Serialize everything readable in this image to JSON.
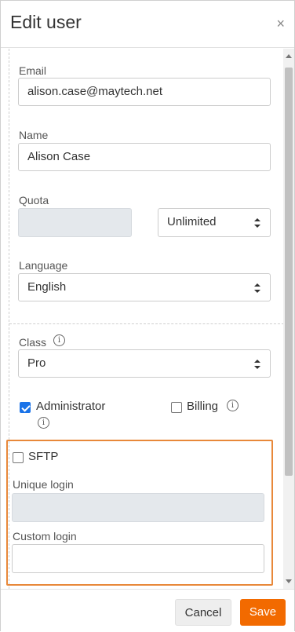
{
  "dialog": {
    "title": "Edit user",
    "close_glyph": "×"
  },
  "form": {
    "email": {
      "label": "Email",
      "value": "alison.case@maytech.net"
    },
    "name": {
      "label": "Name",
      "value": "Alison Case"
    },
    "quota": {
      "label": "Quota",
      "value": "",
      "unit_selected": "Unlimited"
    },
    "language": {
      "label": "Language",
      "selected": "English"
    },
    "class": {
      "label": "Class",
      "selected": "Pro"
    },
    "administrator": {
      "label": "Administrator",
      "checked": true
    },
    "billing": {
      "label": "Billing",
      "checked": false
    },
    "sftp": {
      "label": "SFTP",
      "checked": false,
      "unique_login": {
        "label": "Unique login",
        "value": ""
      },
      "custom_login": {
        "label": "Custom login",
        "value": ""
      }
    }
  },
  "footer": {
    "cancel_label": "Cancel",
    "save_label": "Save"
  },
  "colors": {
    "accent": "#f26a00",
    "checkbox": "#1a73e8",
    "highlight_border": "#e8883a"
  },
  "icons": {
    "info": "info-icon",
    "close": "close-icon",
    "select_arrows": "select-arrows-icon"
  }
}
